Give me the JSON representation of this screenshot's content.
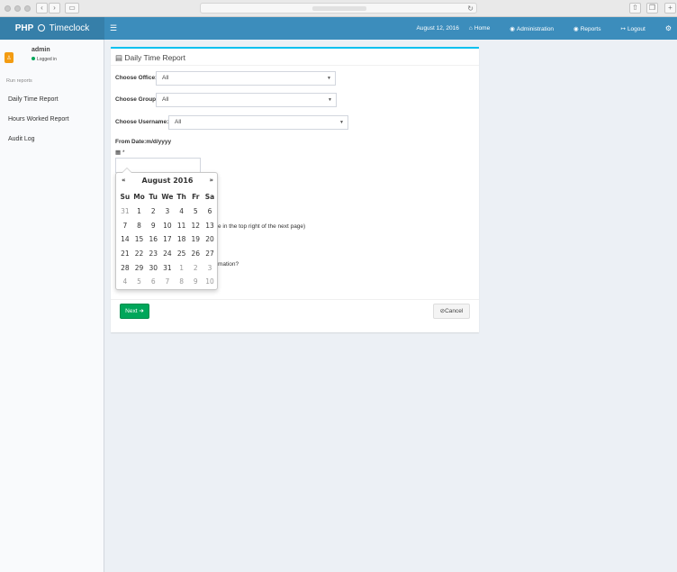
{
  "navbar": {
    "brand_bold": "PHP",
    "brand_rest": "Timeclock",
    "date": "August 12, 2016",
    "home": "Home",
    "administration": "Administration",
    "reports": "Reports",
    "logout": "Logout"
  },
  "user": {
    "name": "admin",
    "status": "Logged in"
  },
  "sidebar": {
    "section": "Run reports",
    "items": [
      {
        "label": "Daily Time Report"
      },
      {
        "label": "Hours Worked Report"
      },
      {
        "label": "Audit Log"
      }
    ]
  },
  "report": {
    "title": "Daily Time Report",
    "office_label": "Choose Office:",
    "office_value": "All",
    "group_label": "Choose Group:",
    "group_value": "All",
    "username_label": "Choose Username:",
    "username_value": "All",
    "from_date_label": "From Date:m/d/yyyy",
    "required_mark": "*",
    "partial_1": "e in the top right of the next page)",
    "partial_2": "mation?",
    "next": "Next",
    "cancel": "Cancel"
  },
  "datepicker": {
    "prev": "«",
    "next": "»",
    "title": "August 2016",
    "dow": [
      "Su",
      "Mo",
      "Tu",
      "We",
      "Th",
      "Fr",
      "Sa"
    ],
    "weeks": [
      [
        {
          "d": "31",
          "m": true
        },
        {
          "d": "1"
        },
        {
          "d": "2"
        },
        {
          "d": "3"
        },
        {
          "d": "4"
        },
        {
          "d": "5"
        },
        {
          "d": "6"
        }
      ],
      [
        {
          "d": "7"
        },
        {
          "d": "8"
        },
        {
          "d": "9"
        },
        {
          "d": "10"
        },
        {
          "d": "11"
        },
        {
          "d": "12"
        },
        {
          "d": "13"
        }
      ],
      [
        {
          "d": "14"
        },
        {
          "d": "15"
        },
        {
          "d": "16"
        },
        {
          "d": "17"
        },
        {
          "d": "18"
        },
        {
          "d": "19"
        },
        {
          "d": "20"
        }
      ],
      [
        {
          "d": "21"
        },
        {
          "d": "22"
        },
        {
          "d": "23"
        },
        {
          "d": "24"
        },
        {
          "d": "25"
        },
        {
          "d": "26"
        },
        {
          "d": "27"
        }
      ],
      [
        {
          "d": "28"
        },
        {
          "d": "29"
        },
        {
          "d": "30"
        },
        {
          "d": "31"
        },
        {
          "d": "1",
          "m": true
        },
        {
          "d": "2",
          "m": true
        },
        {
          "d": "3",
          "m": true
        }
      ],
      [
        {
          "d": "4",
          "m": true
        },
        {
          "d": "5",
          "m": true
        },
        {
          "d": "6",
          "m": true
        },
        {
          "d": "7",
          "m": true
        },
        {
          "d": "8",
          "m": true
        },
        {
          "d": "9",
          "m": true
        },
        {
          "d": "10",
          "m": true
        }
      ]
    ]
  }
}
